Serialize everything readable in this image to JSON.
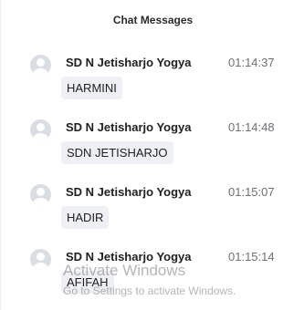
{
  "panel": {
    "title": "Chat Messages"
  },
  "messages": [
    {
      "sender": "SD N Jetisharjo Yogya",
      "time": "01:14:37",
      "text": "HARMINI",
      "avatar_icon": "user-avatar-icon"
    },
    {
      "sender": "SD N Jetisharjo Yogya",
      "time": "01:14:48",
      "text": "SDN JETISHARJO",
      "avatar_icon": "user-avatar-icon"
    },
    {
      "sender": "SD N Jetisharjo Yogya",
      "time": "01:15:07",
      "text": "HADIR",
      "avatar_icon": "user-avatar-icon"
    },
    {
      "sender": "SD N Jetisharjo Yogya",
      "time": "01:15:14",
      "text": "AFIFAH",
      "avatar_icon": "user-avatar-icon"
    }
  ],
  "watermark": {
    "title": "Activate Windows",
    "subtitle": "Go to Settings to activate Windows."
  },
  "colors": {
    "background": "#ffffff",
    "bubble": "#eef0f4",
    "avatar": "#dadde2",
    "timestamp": "#6d6f73"
  }
}
